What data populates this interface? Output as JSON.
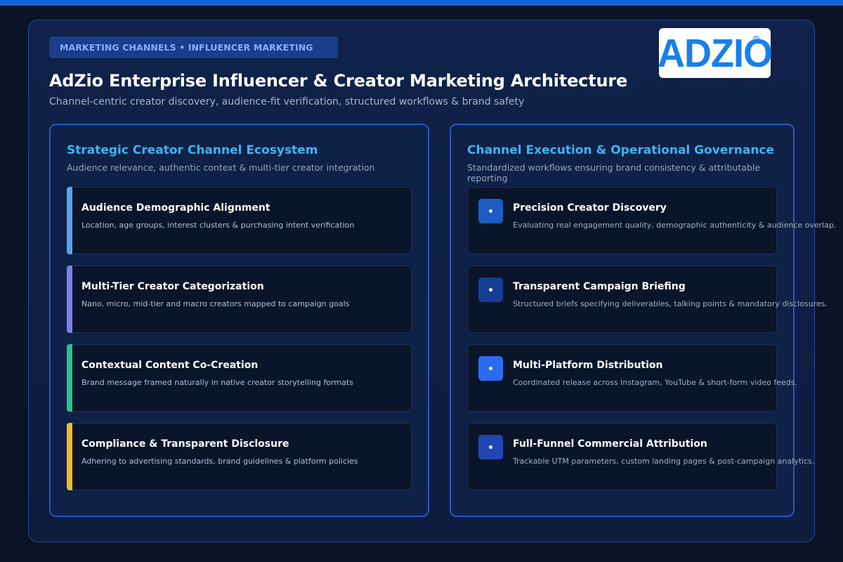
{
  "breadcrumb": "MARKETING CHANNELS • INFLUENCER MARKETING",
  "logo": {
    "text": "ADZIO",
    "mark": "®"
  },
  "title": "AdZio Enterprise Influencer & Creator Marketing Architecture",
  "subtitle": "Channel-centric creator discovery, audience-fit verification, structured workflows & brand safety",
  "left_panel": {
    "title": "Strategic Creator Channel Ecosystem",
    "subtitle": "Audience relevance, authentic context & multi-tier creator integration",
    "cards": [
      {
        "title": "Audience Demographic Alignment",
        "desc": "Location, age groups, interest clusters & purchasing intent verification",
        "accent": "#5aa2f0"
      },
      {
        "title": "Multi-Tier Creator Categorization",
        "desc": "Nano, micro, mid-tier and macro creators mapped to campaign goals",
        "accent": "#7a80e8"
      },
      {
        "title": "Contextual Content Co-Creation",
        "desc": "Brand message framed naturally in native creator storytelling formats",
        "accent": "#2fc08e"
      },
      {
        "title": "Compliance & Transparent Disclosure",
        "desc": "Adhering to advertising standards, brand guidelines & platform policies",
        "accent": "#f2bd2c"
      }
    ]
  },
  "right_panel": {
    "title": "Channel Execution & Operational Governance",
    "subtitle": "Standardized workflows ensuring brand consistency & attributable reporting",
    "cards": [
      {
        "title": "Precision Creator Discovery",
        "desc": "Evaluating real engagement quality, demographic authenticity & audience overlap.",
        "icon_color": "#1c5cc4",
        "icon": "dot-icon"
      },
      {
        "title": "Transparent Campaign Briefing",
        "desc": "Structured briefs specifying deliverables, talking points & mandatory disclosures.",
        "icon_color": "#143e93",
        "icon": "dot-icon"
      },
      {
        "title": "Multi-Platform Distribution",
        "desc": "Coordinated release across Instagram, YouTube & short-form video feeds.",
        "icon_color": "#2a6cf0",
        "icon": "dot-icon"
      },
      {
        "title": "Full-Funnel Commercial Attribution",
        "desc": "Trackable UTM parameters, custom landing pages & post-campaign analytics.",
        "icon_color": "#1f46b4",
        "icon": "dot-icon"
      }
    ]
  }
}
